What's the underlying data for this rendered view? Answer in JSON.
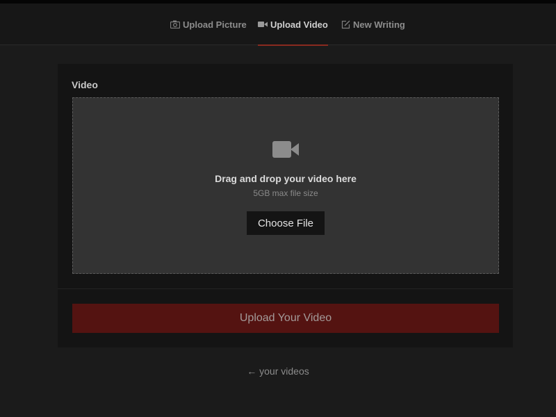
{
  "tabs": [
    {
      "label": "Upload Picture",
      "icon": "camera-icon",
      "active": false
    },
    {
      "label": "Upload Video",
      "icon": "video-camera-icon",
      "active": true
    },
    {
      "label": "New Writing",
      "icon": "edit-icon",
      "active": false
    }
  ],
  "form": {
    "field_label": "Video",
    "dropzone": {
      "icon": "video-camera-icon",
      "title": "Drag and drop your video here",
      "subtitle": "5GB max file size",
      "choose_label": "Choose File"
    },
    "submit_label": "Upload Your Video"
  },
  "footer": {
    "back_arrow": "←",
    "back_label": "your videos"
  },
  "colors": {
    "background": "#1b1b1b",
    "panel": "#141414",
    "dropzone": "#333333",
    "accent": "#8a2a1f",
    "submit": "#541311"
  }
}
